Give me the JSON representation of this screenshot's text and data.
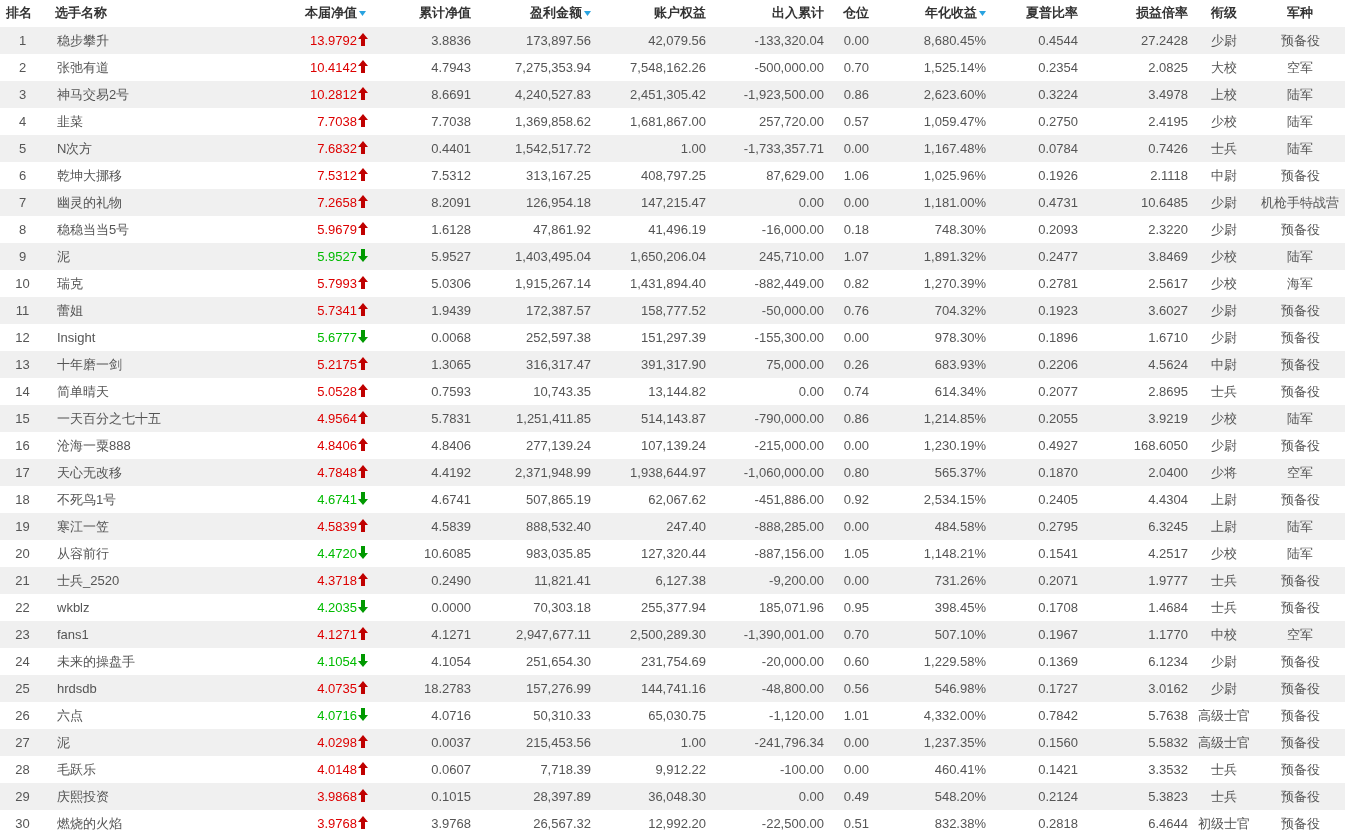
{
  "columns": [
    {
      "label": "排名",
      "sortable": false
    },
    {
      "label": "选手名称",
      "sortable": false
    },
    {
      "label": "本届净值",
      "sortable": true
    },
    {
      "label": "累计净值",
      "sortable": false
    },
    {
      "label": "盈利金额",
      "sortable": true
    },
    {
      "label": "账户权益",
      "sortable": false
    },
    {
      "label": "出入累计",
      "sortable": false
    },
    {
      "label": "仓位",
      "sortable": false
    },
    {
      "label": "年化收益",
      "sortable": true
    },
    {
      "label": "夏普比率",
      "sortable": false
    },
    {
      "label": "损益倍率",
      "sortable": false
    },
    {
      "label": "衔级",
      "sortable": false
    },
    {
      "label": "军种",
      "sortable": false
    }
  ],
  "rows": [
    {
      "up": true,
      "cells": [
        "1",
        "稳步攀升",
        "13.9792",
        "3.8836",
        "173,897.56",
        "42,079.56",
        "-133,320.04",
        "0.00",
        "8,680.45%",
        "0.4544",
        "27.2428",
        "少尉",
        "预备役"
      ]
    },
    {
      "up": true,
      "cells": [
        "2",
        "张弛有道",
        "10.4142",
        "4.7943",
        "7,275,353.94",
        "7,548,162.26",
        "-500,000.00",
        "0.70",
        "1,525.14%",
        "0.2354",
        "2.0825",
        "大校",
        "空军"
      ]
    },
    {
      "up": true,
      "cells": [
        "3",
        "神马交易2号",
        "10.2812",
        "8.6691",
        "4,240,527.83",
        "2,451,305.42",
        "-1,923,500.00",
        "0.86",
        "2,623.60%",
        "0.3224",
        "3.4978",
        "上校",
        "陆军"
      ]
    },
    {
      "up": true,
      "cells": [
        "4",
        "韭菜",
        "7.7038",
        "7.7038",
        "1,369,858.62",
        "1,681,867.00",
        "257,720.00",
        "0.57",
        "1,059.47%",
        "0.2750",
        "2.4195",
        "少校",
        "陆军"
      ]
    },
    {
      "up": true,
      "cells": [
        "5",
        "N次方",
        "7.6832",
        "0.4401",
        "1,542,517.72",
        "1.00",
        "-1,733,357.71",
        "0.00",
        "1,167.48%",
        "0.0784",
        "0.7426",
        "士兵",
        "陆军"
      ]
    },
    {
      "up": true,
      "cells": [
        "6",
        "乾坤大挪移",
        "7.5312",
        "7.5312",
        "313,167.25",
        "408,797.25",
        "87,629.00",
        "1.06",
        "1,025.96%",
        "0.1926",
        "2.1118",
        "中尉",
        "预备役"
      ]
    },
    {
      "up": true,
      "cells": [
        "7",
        "幽灵的礼物",
        "7.2658",
        "8.2091",
        "126,954.18",
        "147,215.47",
        "0.00",
        "0.00",
        "1,181.00%",
        "0.4731",
        "10.6485",
        "少尉",
        "机枪手特战营"
      ]
    },
    {
      "up": true,
      "cells": [
        "8",
        "稳稳当当5号",
        "5.9679",
        "1.6128",
        "47,861.92",
        "41,496.19",
        "-16,000.00",
        "0.18",
        "748.30%",
        "0.2093",
        "2.3220",
        "少尉",
        "预备役"
      ]
    },
    {
      "up": false,
      "cells": [
        "9",
        "泥",
        "5.9527",
        "5.9527",
        "1,403,495.04",
        "1,650,206.04",
        "245,710.00",
        "1.07",
        "1,891.32%",
        "0.2477",
        "3.8469",
        "少校",
        "陆军"
      ]
    },
    {
      "up": true,
      "cells": [
        "10",
        "瑞克",
        "5.7993",
        "5.0306",
        "1,915,267.14",
        "1,431,894.40",
        "-882,449.00",
        "0.82",
        "1,270.39%",
        "0.2781",
        "2.5617",
        "少校",
        "海军"
      ]
    },
    {
      "up": true,
      "cells": [
        "11",
        "蕾姐",
        "5.7341",
        "1.9439",
        "172,387.57",
        "158,777.52",
        "-50,000.00",
        "0.76",
        "704.32%",
        "0.1923",
        "3.6027",
        "少尉",
        "预备役"
      ]
    },
    {
      "up": false,
      "cells": [
        "12",
        "Insight",
        "5.6777",
        "0.0068",
        "252,597.38",
        "151,297.39",
        "-155,300.00",
        "0.00",
        "978.30%",
        "0.1896",
        "1.6710",
        "少尉",
        "预备役"
      ]
    },
    {
      "up": true,
      "cells": [
        "13",
        "十年磨一剑",
        "5.2175",
        "1.3065",
        "316,317.47",
        "391,317.90",
        "75,000.00",
        "0.26",
        "683.93%",
        "0.2206",
        "4.5624",
        "中尉",
        "预备役"
      ]
    },
    {
      "up": true,
      "cells": [
        "14",
        "简单晴天",
        "5.0528",
        "0.7593",
        "10,743.35",
        "13,144.82",
        "0.00",
        "0.74",
        "614.34%",
        "0.2077",
        "2.8695",
        "士兵",
        "预备役"
      ]
    },
    {
      "up": true,
      "cells": [
        "15",
        "一天百分之七十五",
        "4.9564",
        "5.7831",
        "1,251,411.85",
        "514,143.87",
        "-790,000.00",
        "0.86",
        "1,214.85%",
        "0.2055",
        "3.9219",
        "少校",
        "陆军"
      ]
    },
    {
      "up": true,
      "cells": [
        "16",
        "沧海一粟888",
        "4.8406",
        "4.8406",
        "277,139.24",
        "107,139.24",
        "-215,000.00",
        "0.00",
        "1,230.19%",
        "0.4927",
        "168.6050",
        "少尉",
        "预备役"
      ]
    },
    {
      "up": true,
      "cells": [
        "17",
        "天心无改移",
        "4.7848",
        "4.4192",
        "2,371,948.99",
        "1,938,644.97",
        "-1,060,000.00",
        "0.80",
        "565.37%",
        "0.1870",
        "2.0400",
        "少将",
        "空军"
      ]
    },
    {
      "up": false,
      "cells": [
        "18",
        "不死鸟1号",
        "4.6741",
        "4.6741",
        "507,865.19",
        "62,067.62",
        "-451,886.00",
        "0.92",
        "2,534.15%",
        "0.2405",
        "4.4304",
        "上尉",
        "预备役"
      ]
    },
    {
      "up": true,
      "cells": [
        "19",
        "寒江一笠",
        "4.5839",
        "4.5839",
        "888,532.40",
        "247.40",
        "-888,285.00",
        "0.00",
        "484.58%",
        "0.2795",
        "6.3245",
        "上尉",
        "陆军"
      ]
    },
    {
      "up": false,
      "cells": [
        "20",
        "从容前行",
        "4.4720",
        "10.6085",
        "983,035.85",
        "127,320.44",
        "-887,156.00",
        "1.05",
        "1,148.21%",
        "0.1541",
        "4.2517",
        "少校",
        "陆军"
      ]
    },
    {
      "up": true,
      "cells": [
        "21",
        "士兵_2520",
        "4.3718",
        "0.2490",
        "11,821.41",
        "6,127.38",
        "-9,200.00",
        "0.00",
        "731.26%",
        "0.2071",
        "1.9777",
        "士兵",
        "预备役"
      ]
    },
    {
      "up": false,
      "cells": [
        "22",
        "wkblz",
        "4.2035",
        "0.0000",
        "70,303.18",
        "255,377.94",
        "185,071.96",
        "0.95",
        "398.45%",
        "0.1708",
        "1.4684",
        "士兵",
        "预备役"
      ]
    },
    {
      "up": true,
      "cells": [
        "23",
        "fans1",
        "4.1271",
        "4.1271",
        "2,947,677.11",
        "2,500,289.30",
        "-1,390,001.00",
        "0.70",
        "507.10%",
        "0.1967",
        "1.1770",
        "中校",
        "空军"
      ]
    },
    {
      "up": false,
      "cells": [
        "24",
        "未来的操盘手",
        "4.1054",
        "4.1054",
        "251,654.30",
        "231,754.69",
        "-20,000.00",
        "0.60",
        "1,229.58%",
        "0.1369",
        "6.1234",
        "少尉",
        "预备役"
      ]
    },
    {
      "up": true,
      "cells": [
        "25",
        "hrdsdb",
        "4.0735",
        "18.2783",
        "157,276.99",
        "144,741.16",
        "-48,800.00",
        "0.56",
        "546.98%",
        "0.1727",
        "3.0162",
        "少尉",
        "预备役"
      ]
    },
    {
      "up": false,
      "cells": [
        "26",
        "六点",
        "4.0716",
        "4.0716",
        "50,310.33",
        "65,030.75",
        "-1,120.00",
        "1.01",
        "4,332.00%",
        "0.7842",
        "5.7638",
        "高级士官",
        "预备役"
      ]
    },
    {
      "up": true,
      "cells": [
        "27",
        "泥",
        "4.0298",
        "0.0037",
        "215,453.56",
        "1.00",
        "-241,796.34",
        "0.00",
        "1,237.35%",
        "0.1560",
        "5.5832",
        "高级士官",
        "预备役"
      ]
    },
    {
      "up": true,
      "cells": [
        "28",
        "毛跃乐",
        "4.0148",
        "0.0607",
        "7,718.39",
        "9,912.22",
        "-100.00",
        "0.00",
        "460.41%",
        "0.1421",
        "3.3532",
        "士兵",
        "预备役"
      ]
    },
    {
      "up": true,
      "cells": [
        "29",
        "庆熙投资",
        "3.9868",
        "0.1015",
        "28,397.89",
        "36,048.30",
        "0.00",
        "0.49",
        "548.20%",
        "0.2124",
        "5.3823",
        "士兵",
        "预备役"
      ]
    },
    {
      "up": true,
      "cells": [
        "30",
        "燃烧的火焰",
        "3.9768",
        "3.9768",
        "26,567.32",
        "12,992.20",
        "-22,500.00",
        "0.51",
        "832.38%",
        "0.2818",
        "6.4644",
        "初级士官",
        "预备役"
      ]
    }
  ]
}
